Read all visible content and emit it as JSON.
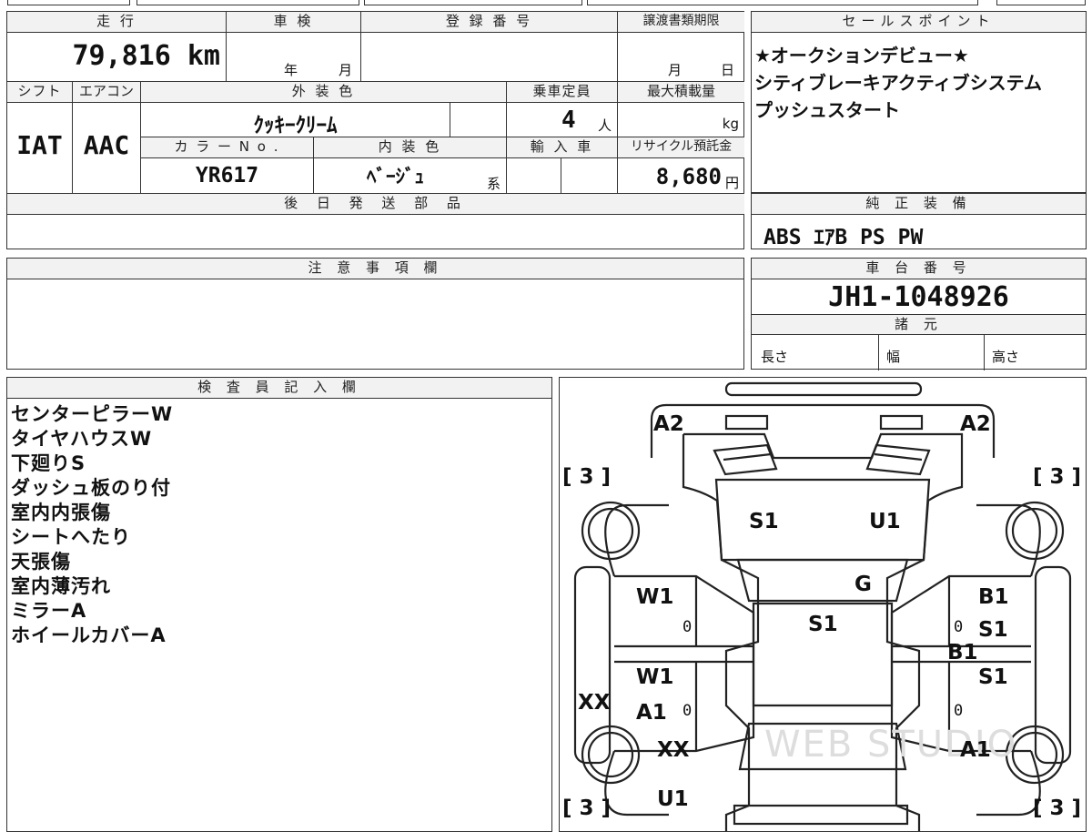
{
  "vehicle": {
    "mileage_label": "走 行",
    "mileage": "79,816 km",
    "inspection_label": "車 検",
    "inspection_year_unit": "年",
    "inspection_month_unit": "月",
    "registration_label": "登 録 番 号",
    "transfer_label": "譲渡書類期限",
    "transfer_month_unit": "月",
    "transfer_day_unit": "日",
    "shift_label": "シフト",
    "shift": "IAT",
    "ac_label": "エアコン",
    "ac": "AAC",
    "exterior_color_label": "外 装 色",
    "exterior_color": "ｸｯｷｰｸﾘｰﾑ",
    "capacity_label": "乗車定員",
    "capacity": "4",
    "capacity_unit": "人",
    "max_load_label": "最大積載量",
    "max_load_unit": "kg",
    "color_no_label": "カ ラ ー N o .",
    "color_no": "YR617",
    "interior_color_label": "内 装 色",
    "interior_color": "ﾍﾞｰｼﾞｭ",
    "interior_color_suffix": "系",
    "import_label": "輸 入 車",
    "recycle_label": "リサイクル預託金",
    "recycle_fee": "8,680",
    "recycle_unit": "円",
    "later_parts_label": "後 日 発 送 部 品"
  },
  "sales_points": {
    "label": "セールスポイント",
    "lines": [
      "★オークションデビュー★",
      "シティブレーキアクティブシステム",
      "プッシュスタート"
    ]
  },
  "equipment": {
    "label": "純 正 装 備",
    "value": "ABS ｴｱB PS PW"
  },
  "caution": {
    "label": "注 意 事 項 欄"
  },
  "chassis": {
    "label": "車 台 番 号",
    "value": "JH1-1048926",
    "specs_label": "諸 元",
    "length_label": "長さ",
    "width_label": "幅",
    "height_label": "高さ"
  },
  "inspector": {
    "label": "検 査 員 記 入 欄",
    "notes": [
      "センターピラーW",
      "タイヤハウスW",
      "下廻りS",
      "ダッシュ板のり付",
      "室内内張傷",
      "シートへたり",
      "天張傷",
      "室内薄汚れ",
      "ミラーA",
      "ホイールカバーA"
    ]
  },
  "diagram": {
    "tire_marks": [
      "[ 3 ]",
      "[ 3 ]",
      "[ 3 ]",
      "[ 3 ]"
    ],
    "damage": {
      "front_left": "A2",
      "front_right": "A2",
      "hood_left": "S1",
      "hood_right": "U1",
      "windshield": "G",
      "roof": "S1",
      "left_front_door": "W1",
      "left_rear_door": "W1",
      "left_rear_door_2": "A1",
      "left_side": "XX",
      "left_rear": "XX",
      "rear": "U1",
      "right_front_door": "B1",
      "right_front_door_2": "S1",
      "right_pillar": "B1",
      "right_rear_door": "S1",
      "right_rear": "A1"
    },
    "zeros": [
      "0",
      "0",
      "0",
      "0"
    ],
    "watermark": "WEB STUDIO"
  }
}
